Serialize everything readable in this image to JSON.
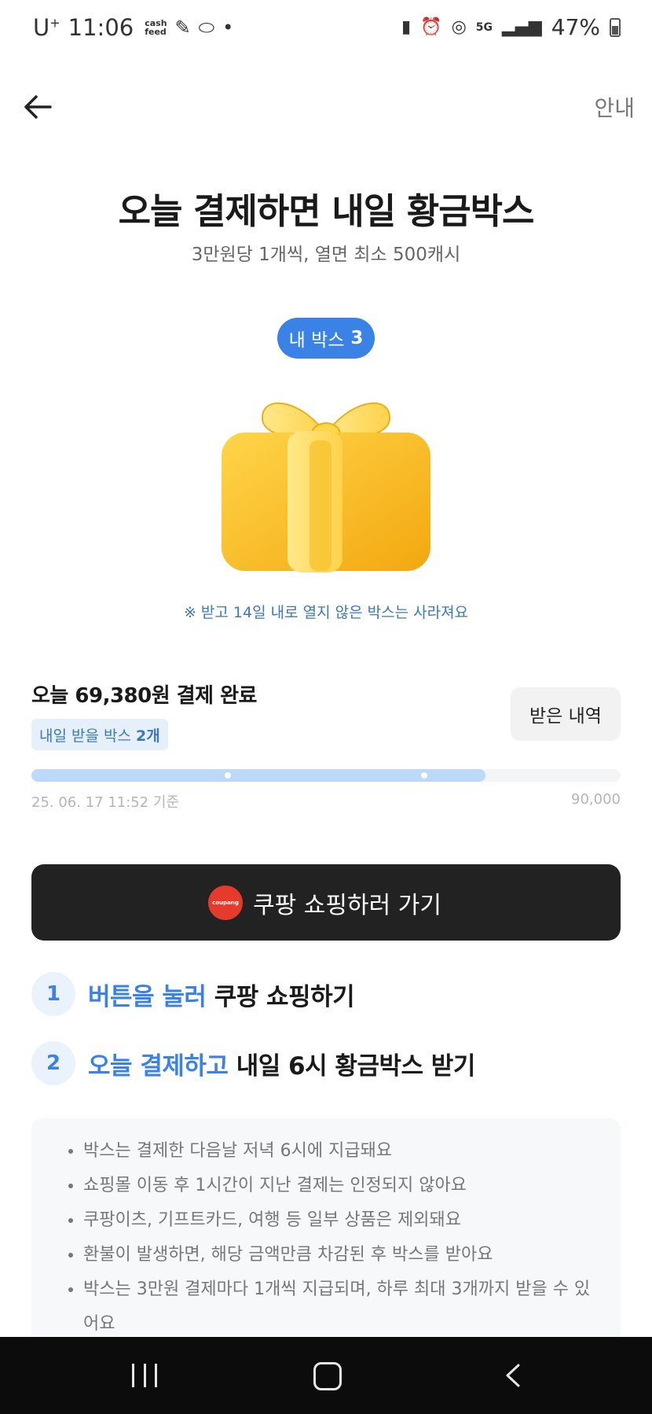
{
  "status_bar": {
    "carrier": "U",
    "carrier_sup": "+",
    "time": "11:06",
    "app_badge_line1": "cash",
    "app_badge_line2": "feed",
    "battery": "47%",
    "network": "5G"
  },
  "header": {
    "info_label": "안내"
  },
  "title": "오늘 결제하면 내일 황금박스",
  "subtitle": "3만원당 1개씩, 열면 최소 500캐시",
  "my_box": {
    "label": "내 박스",
    "count": "3"
  },
  "notice": "※ 받고 14일 내로 열지 않은 박스는 사라져요",
  "payment": {
    "status": "오늘 69,380원 결제 완료",
    "tomorrow_label": "내일 받을 박스",
    "tomorrow_count": "2개",
    "history_button": "받은 내역"
  },
  "progress": {
    "value": 69380,
    "max": 90000,
    "date": "25. 06. 17 11:52 기준",
    "max_label": "90,000",
    "checkpoints": [
      30000,
      60000
    ]
  },
  "shop_button": {
    "label": "쿠팡 쇼핑하러 가기",
    "logo_text": "coupang"
  },
  "steps": [
    {
      "num": "1",
      "highlight": "버튼을 눌러",
      "text": " 쿠팡 쇼핑하기"
    },
    {
      "num": "2",
      "highlight": "오늘 결제하고",
      "text": " 내일 6시 황금박스 받기"
    }
  ],
  "rules": [
    "박스는 결제한 다음날 저녁 6시에 지급돼요",
    "쇼핑몰 이동 후 1시간이 지난 결제는 인정되지 않아요",
    "쿠팡이츠, 기프트카드, 여행 등 일부 상품은 제외돼요",
    "환불이 발생하면, 해당 금액만큼 차감된 후 박스를 받아요",
    "박스는 3만원 결제마다 1개씩 지급되며, 하루 최대 3개까지 받을 수 있어요"
  ],
  "colors": {
    "accent": "#3a82e5",
    "progress_fill": "#bcd9f7",
    "button_dark": "#222222",
    "gift_yellow": "#fbc12f"
  }
}
